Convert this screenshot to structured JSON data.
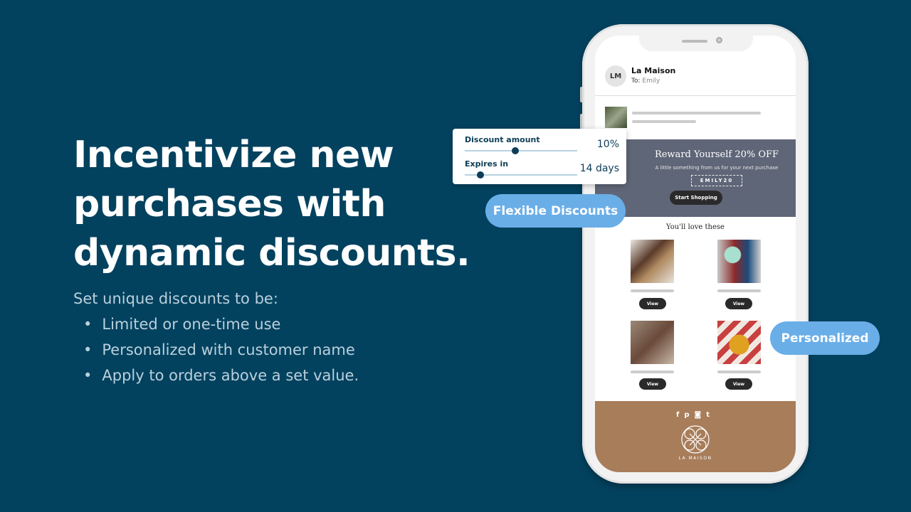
{
  "headline": [
    "Incentivize new",
    "purchases with",
    "dynamic discounts."
  ],
  "subtext": {
    "intro": "Set unique discounts to be:",
    "bullets": [
      "Limited or one-time use",
      "Personalized with customer name",
      "Apply to orders above a set value."
    ]
  },
  "email": {
    "avatar": "LM",
    "sender": "La Maison",
    "to_label": "To:",
    "to": "Emily",
    "banner": {
      "title": "Reward Yourself 20% OFF",
      "subtitle": "A little something from us for your next purchase",
      "code": "EMILY20",
      "button": "Start Shopping"
    },
    "products_heading": "You'll love these",
    "products": [
      {
        "view": "View"
      },
      {
        "view": "View"
      },
      {
        "view": "View"
      },
      {
        "view": "View"
      }
    ],
    "footer": {
      "social_icons": [
        "facebook-icon",
        "pinterest-icon",
        "instagram-icon",
        "twitter-icon"
      ],
      "brand": "LA MAISON"
    }
  },
  "discount_card": {
    "amount_label": "Discount amount",
    "amount_value": "10%",
    "amount_fraction": 0.45,
    "expires_label": "Expires in",
    "expires_value": "14 days",
    "expires_fraction": 0.14
  },
  "pills": {
    "flexible": "Flexible Discounts",
    "personalized": "Personalized"
  },
  "colors": {
    "background": "#03425f",
    "pill": "#6aaee8",
    "banner": "#5f6677",
    "footer": "#a87d5a"
  }
}
